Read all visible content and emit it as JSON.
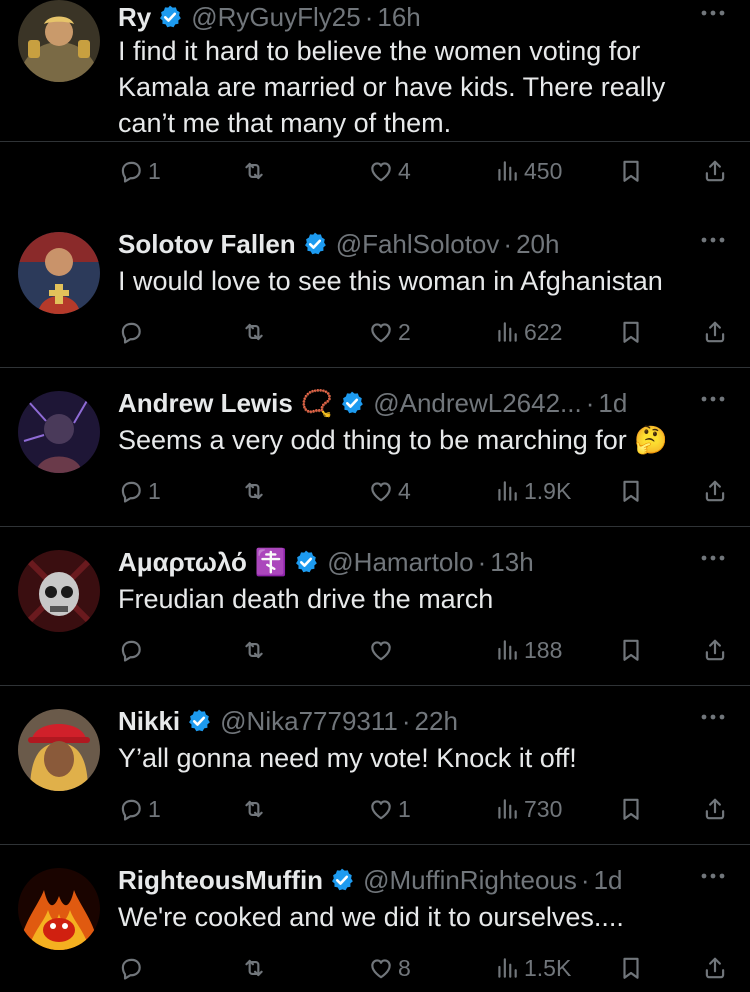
{
  "tweets": [
    {
      "name": "Ry",
      "handle": "@RyGuyFly25",
      "dot": "·",
      "time": "16h",
      "text": "I find it hard to believe the women voting for Kamala are married or have kids. There really can’t me that many of them.",
      "replies": "1",
      "retweets": "",
      "likes": "4",
      "views": "450"
    },
    {
      "name": "Solotov Fallen",
      "handle": "@FahlSolotov",
      "dot": "·",
      "time": "20h",
      "text": "I would love to see this woman in Afghanistan",
      "replies": "",
      "retweets": "",
      "likes": "2",
      "views": "622"
    },
    {
      "name": "Andrew Lewis",
      "name_emoji": "📿",
      "handle": "@AndrewL2642...",
      "dot": "·",
      "time": "1d",
      "text": "Seems a very odd thing to be marching for 🤔",
      "replies": "1",
      "retweets": "",
      "likes": "4",
      "views": "1.9K"
    },
    {
      "name": "Αμαρτωλό",
      "name_emoji": "☦️",
      "handle": "@Hamartolo",
      "dot": "·",
      "time": "13h",
      "text": "Freudian death drive the march",
      "replies": "",
      "retweets": "",
      "likes": "",
      "views": "188"
    },
    {
      "name": "Nikki",
      "handle": "@Nika7779311",
      "dot": "·",
      "time": "22h",
      "text": "Y’all gonna need my vote! Knock it off!",
      "replies": "1",
      "retweets": "",
      "likes": "1",
      "views": "730"
    },
    {
      "name": "RighteousMuffin",
      "handle": "@MuffinRighteous",
      "dot": "·",
      "time": "1d",
      "text": "We're cooked and we did it to ourselves....",
      "replies": "",
      "retweets": "",
      "likes": "8",
      "views": "1.5K"
    }
  ],
  "icons": {
    "verified": "verified-badge-icon",
    "more": "more-icon",
    "reply": "reply-icon",
    "retweet": "retweet-icon",
    "like": "heart-icon",
    "views": "views-icon",
    "bookmark": "bookmark-icon",
    "share": "share-icon"
  },
  "colors": {
    "background": "#000000",
    "text": "#e7e9ea",
    "muted": "#71767b",
    "verified": "#1d9bf0",
    "divider": "#2f3336"
  }
}
